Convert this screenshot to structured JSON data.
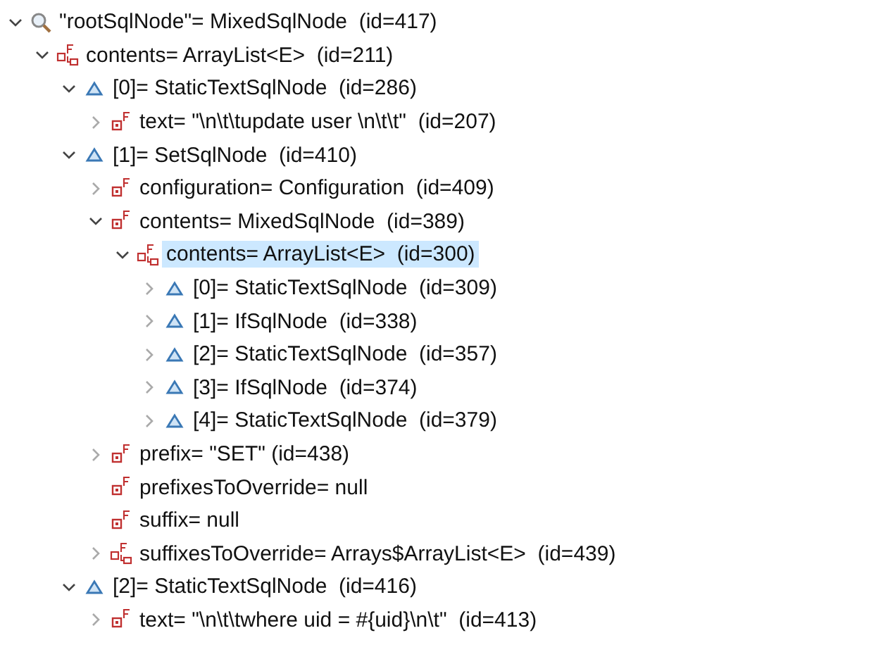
{
  "tree": [
    {
      "kind": "watch",
      "label": "\"rootSqlNode\"= MixedSqlNode  (id=417)",
      "expandable": true,
      "expanded": true,
      "selected": false,
      "children": [
        {
          "kind": "array-field",
          "label": "contents= ArrayList<E>  (id=211)",
          "expandable": true,
          "expanded": true,
          "selected": false,
          "children": [
            {
              "kind": "element",
              "label": "[0]= StaticTextSqlNode  (id=286)",
              "expandable": true,
              "expanded": true,
              "selected": false,
              "children": [
                {
                  "kind": "field",
                  "label": "text= \"\\n\\t\\tupdate user \\n\\t\\t\"  (id=207)",
                  "expandable": true,
                  "expanded": false,
                  "selected": false
                }
              ]
            },
            {
              "kind": "element",
              "label": "[1]= SetSqlNode  (id=410)",
              "expandable": true,
              "expanded": true,
              "selected": false,
              "children": [
                {
                  "kind": "field",
                  "label": "configuration= Configuration  (id=409)",
                  "expandable": true,
                  "expanded": false,
                  "selected": false
                },
                {
                  "kind": "field",
                  "label": "contents= MixedSqlNode  (id=389)",
                  "expandable": true,
                  "expanded": true,
                  "selected": false,
                  "children": [
                    {
                      "kind": "array-field",
                      "label": "contents= ArrayList<E>  (id=300)",
                      "expandable": true,
                      "expanded": true,
                      "selected": true,
                      "children": [
                        {
                          "kind": "element",
                          "label": "[0]= StaticTextSqlNode  (id=309)",
                          "expandable": true,
                          "expanded": false,
                          "selected": false
                        },
                        {
                          "kind": "element",
                          "label": "[1]= IfSqlNode  (id=338)",
                          "expandable": true,
                          "expanded": false,
                          "selected": false
                        },
                        {
                          "kind": "element",
                          "label": "[2]= StaticTextSqlNode  (id=357)",
                          "expandable": true,
                          "expanded": false,
                          "selected": false
                        },
                        {
                          "kind": "element",
                          "label": "[3]= IfSqlNode  (id=374)",
                          "expandable": true,
                          "expanded": false,
                          "selected": false
                        },
                        {
                          "kind": "element",
                          "label": "[4]= StaticTextSqlNode  (id=379)",
                          "expandable": true,
                          "expanded": false,
                          "selected": false
                        }
                      ]
                    }
                  ]
                },
                {
                  "kind": "field",
                  "label": "prefix= \"SET\" (id=438)",
                  "expandable": true,
                  "expanded": false,
                  "selected": false
                },
                {
                  "kind": "field",
                  "label": "prefixesToOverride= null",
                  "expandable": false,
                  "selected": false
                },
                {
                  "kind": "field",
                  "label": "suffix= null",
                  "expandable": false,
                  "selected": false
                },
                {
                  "kind": "array-field",
                  "label": "suffixesToOverride= Arrays$ArrayList<E>  (id=439)",
                  "expandable": true,
                  "expanded": false,
                  "selected": false
                }
              ]
            },
            {
              "kind": "element",
              "label": "[2]= StaticTextSqlNode  (id=416)",
              "expandable": true,
              "expanded": true,
              "selected": false,
              "children": [
                {
                  "kind": "field",
                  "label": "text= \"\\n\\t\\twhere uid = #{uid}\\n\\t\"  (id=413)",
                  "expandable": true,
                  "expanded": false,
                  "selected": false
                }
              ]
            }
          ]
        }
      ]
    }
  ]
}
